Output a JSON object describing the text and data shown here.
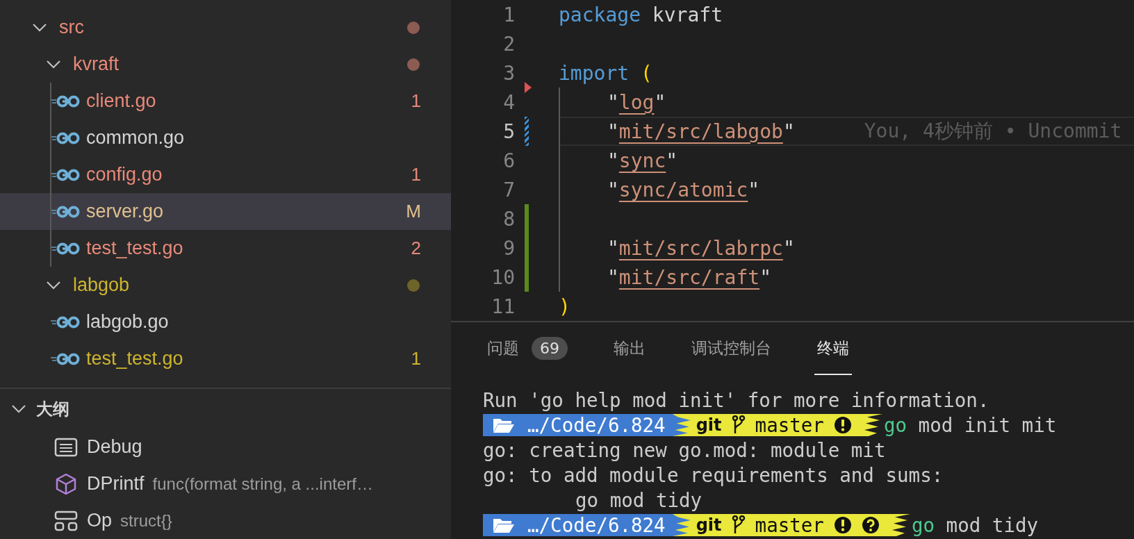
{
  "explorer": {
    "items": [
      {
        "label": "src",
        "kind": "folder",
        "expanded": true,
        "selected": false,
        "indent_guide": false,
        "color": "#e8897a",
        "decoration": {
          "kind": "dot",
          "color": "#8c5b52"
        },
        "children": [
          {
            "label": "kvraft",
            "kind": "folder",
            "expanded": true,
            "selected": false,
            "indent_guide": true,
            "color": "#e8897a",
            "decoration": {
              "kind": "dot",
              "color": "#8c5b52"
            },
            "children": [
              {
                "label": "client.go",
                "kind": "file",
                "selected": false,
                "color": "#e8897a",
                "decoration": {
                  "kind": "text",
                  "text": "1"
                }
              },
              {
                "label": "common.go",
                "kind": "file",
                "selected": false,
                "color": "#d4d4d4"
              },
              {
                "label": "config.go",
                "kind": "file",
                "selected": false,
                "color": "#e8897a",
                "decoration": {
                  "kind": "text",
                  "text": "1"
                }
              },
              {
                "label": "server.go",
                "kind": "file",
                "selected": true,
                "color": "#e2c08d",
                "decoration": {
                  "kind": "text",
                  "text": "M"
                }
              },
              {
                "label": "test_test.go",
                "kind": "file",
                "selected": false,
                "color": "#e8897a",
                "decoration": {
                  "kind": "text",
                  "text": "2"
                }
              }
            ]
          },
          {
            "label": "labgob",
            "kind": "folder",
            "expanded": true,
            "selected": false,
            "indent_guide": false,
            "color": "#cdb52f",
            "decoration": {
              "kind": "dot",
              "color": "#6e6429"
            },
            "children": [
              {
                "label": "labgob.go",
                "kind": "file",
                "selected": false,
                "color": "#d4d4d4"
              },
              {
                "label": "test_test.go",
                "kind": "file",
                "selected": false,
                "color": "#cdb52f",
                "decoration": {
                  "kind": "text",
                  "text": "1"
                }
              }
            ]
          }
        ]
      }
    ]
  },
  "outline": {
    "title": "大纲",
    "expanded": true,
    "items": [
      {
        "name": "Debug",
        "kind": "constant"
      },
      {
        "name": "DPrintf",
        "kind": "function",
        "detail": "func(format string, a ...interf…"
      },
      {
        "name": "Op",
        "kind": "struct",
        "detail": "struct{}"
      }
    ]
  },
  "editor": {
    "lines": [
      {
        "number": "1",
        "current": false,
        "indent": false,
        "tokens": [
          {
            "text": "package",
            "kind": "keyword"
          },
          {
            "text": "kvraft",
            "kind": "plain"
          }
        ]
      },
      {
        "number": "2",
        "current": false,
        "indent": false
      },
      {
        "number": "3",
        "current": false,
        "indent": false,
        "marker": {
          "kind": "deleted"
        },
        "tokens": [
          {
            "text": "import",
            "kind": "keyword"
          },
          {
            "text": "(",
            "kind": "paren"
          }
        ]
      },
      {
        "number": "4",
        "current": false,
        "indent": true,
        "tokens": [
          {
            "text": "\"",
            "kind": "quote"
          },
          {
            "text": "log",
            "kind": "path"
          },
          {
            "text": "\"",
            "kind": "quote"
          }
        ]
      },
      {
        "number": "5",
        "current": true,
        "marker": {
          "kind": "modified"
        },
        "indent": true,
        "blame": "You, 4秒钟前 • Uncommit",
        "tokens": [
          {
            "text": "\"",
            "kind": "quote"
          },
          {
            "text": "mit/src/labgob",
            "kind": "path"
          },
          {
            "text": "\"",
            "kind": "quote"
          }
        ]
      },
      {
        "number": "6",
        "current": false,
        "indent": true,
        "tokens": [
          {
            "text": "\"",
            "kind": "quote"
          },
          {
            "text": "sync",
            "kind": "path"
          },
          {
            "text": "\"",
            "kind": "quote"
          }
        ]
      },
      {
        "number": "7",
        "current": false,
        "indent": true,
        "tokens": [
          {
            "text": "\"",
            "kind": "quote"
          },
          {
            "text": "sync/atomic",
            "kind": "path"
          },
          {
            "text": "\"",
            "kind": "quote"
          }
        ]
      },
      {
        "number": "8",
        "current": false,
        "marker": {
          "kind": "added"
        },
        "indent": true
      },
      {
        "number": "9",
        "current": false,
        "marker": {
          "kind": "added"
        },
        "indent": true,
        "tokens": [
          {
            "text": "\"",
            "kind": "quote"
          },
          {
            "text": "mit/src/labrpc",
            "kind": "path"
          },
          {
            "text": "\"",
            "kind": "quote"
          }
        ]
      },
      {
        "number": "10",
        "current": false,
        "marker": {
          "kind": "added"
        },
        "indent": true,
        "tokens": [
          {
            "text": "\"",
            "kind": "quote"
          },
          {
            "text": "mit/src/raft",
            "kind": "path"
          },
          {
            "text": "\"",
            "kind": "quote"
          }
        ]
      },
      {
        "number": "11",
        "current": false,
        "indent": false,
        "tokens": [
          {
            "text": ")",
            "kind": "paren"
          }
        ]
      }
    ]
  },
  "panel": {
    "tabs": [
      {
        "label": "问题",
        "badge": "69",
        "selected": false
      },
      {
        "label": "输出",
        "selected": false
      },
      {
        "label": "调试控制台",
        "selected": false
      },
      {
        "label": "终端",
        "selected": true
      }
    ],
    "terminal": [
      {
        "kind": "output",
        "text": "Run 'go help mod init' for more information."
      },
      {
        "kind": "prompt",
        "path": "…/Code/6.824",
        "vcs": "git",
        "branch": "master",
        "status_icons": [
          {
            "kind": "exclamation"
          }
        ],
        "command": {
          "program": "go",
          "args": "mod init mit"
        }
      },
      {
        "kind": "output",
        "text": "go: creating new go.mod: module mit"
      },
      {
        "kind": "output",
        "text": "go: to add module requirements and sums:"
      },
      {
        "kind": "indented-output",
        "text": "go mod tidy"
      },
      {
        "kind": "prompt",
        "path": "…/Code/6.824",
        "vcs": "git",
        "branch": "master",
        "status_icons": [
          {
            "kind": "exclamation"
          },
          {
            "kind": "question"
          }
        ],
        "command": {
          "program": "go",
          "args": "mod tidy"
        }
      }
    ]
  }
}
